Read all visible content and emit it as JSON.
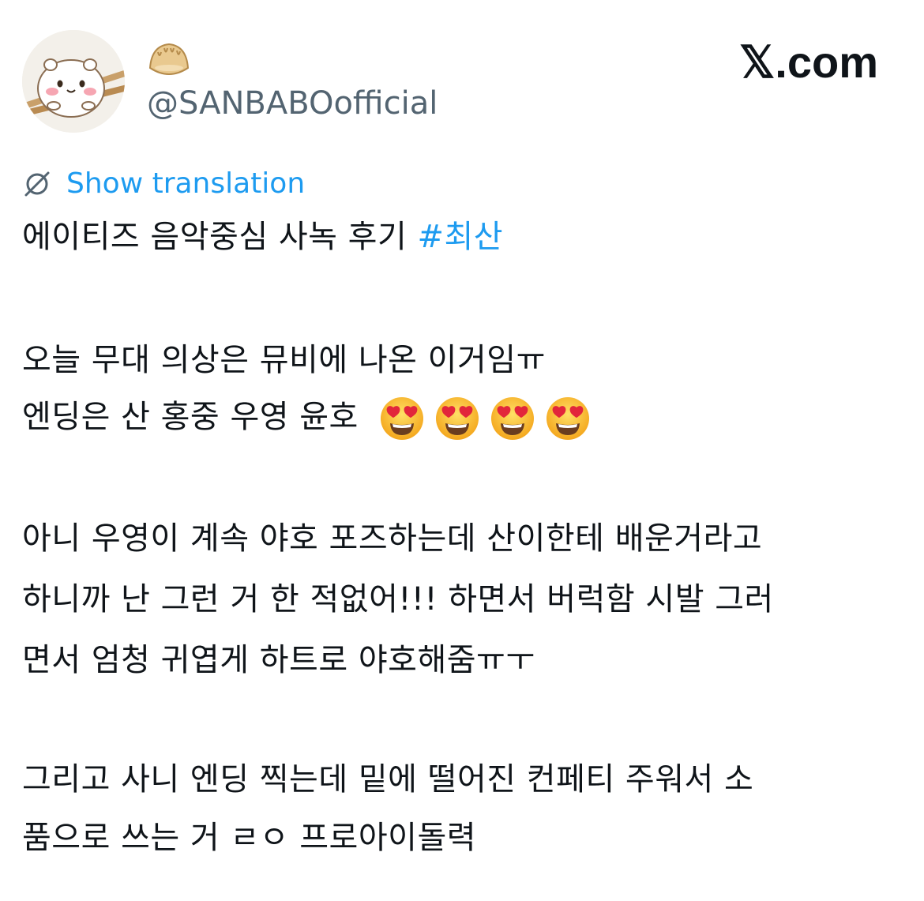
{
  "post": {
    "handle": "@SANBABOofficial",
    "brand": "𝕏.com",
    "translate_label": "Show translation",
    "line1": "에이티즈 음악중심 사녹 후기 ",
    "hashtag": "#최산",
    "line2": "오늘 무대 의상은 뮤비에 나온 이거임ㅠ",
    "line3": "엔딩은 산 홍중 우영 윤호",
    "line3_emoji_count": 4,
    "line4": "아니 우영이 계속 야호 포즈하는데 산이한테 배운거라고",
    "line5": "하니까 난 그런 거 한 적없어!!! 하면서 버럭함 시발 그러",
    "line6": "면서 엄청 귀엽게 하트로 야호해줌ㅠㅜ",
    "line7": "그리고 사니 엔딩 찍는데 밑에 떨어진 컨페티 주워서 소",
    "line8": "품으로 쓰는 거 ㄹㅇ 프로아이돌력"
  },
  "icons": {
    "avatar": "hamster-avatar",
    "name_emoji": "dumpling-icon",
    "translate": "translate-globe-icon",
    "emoji": "heart-eyes-emoji"
  },
  "colors": {
    "link": "#1d9bf0",
    "secondary_text": "#536471",
    "text": "#0f1419"
  }
}
